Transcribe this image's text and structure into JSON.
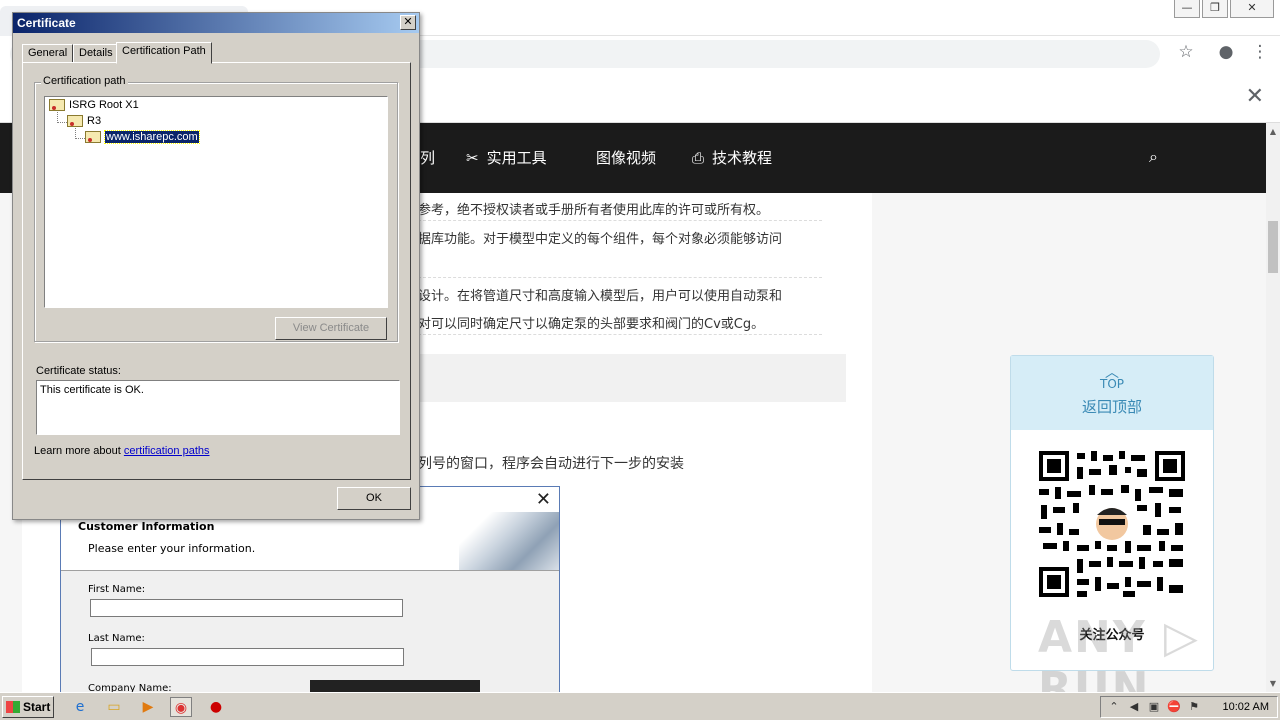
{
  "browser": {
    "window_buttons": [
      "—",
      "❐",
      "✕"
    ],
    "toolbar_icons": [
      "star-icon",
      "account-icon",
      "menu-icon"
    ],
    "infobar_close": "✕"
  },
  "site": {
    "nav": [
      {
        "icon": "",
        "label": "列"
      },
      {
        "icon": "✂",
        "label": "实用工具"
      },
      {
        "icon": "",
        "label": "图像视频"
      },
      {
        "icon": "⎙",
        "label": "技术教程"
      }
    ],
    "search_icon": "⌕"
  },
  "article": {
    "lines": [
      "参考，绝不授权读者或手册所有者使用此库的许可或所有权。",
      "据库功能。对于模型中定义的每个组件，每个对象必须能够访问",
      "设计。在将管道尺寸和高度输入模型后，用户可以使用自动泵和",
      "对可以同时确定尺寸以确定泵的头部要求和阀门的Cv或Cg。"
    ],
    "install_text": "列号的窗口，程序会自动进行下一步的安装"
  },
  "installer": {
    "close": "✕",
    "title": "Customer Information",
    "subtitle": "Please enter your information.",
    "first_name_label": "First Name:",
    "last_name_label": "Last Name:",
    "company_label": "Company Name:"
  },
  "sidebar": {
    "top_arrow": "︿",
    "top_label": "TOP",
    "back_to_top": "返回顶部",
    "qr_caption": "关注公众号"
  },
  "watermark": "ANY ▷ RUN",
  "certificate": {
    "title": "Certificate",
    "close": "✕",
    "tabs": [
      "General",
      "Details",
      "Certification Path"
    ],
    "active_tab": "Certification Path",
    "path_group_label": "Certification path",
    "tree": [
      {
        "label": "ISRG Root X1",
        "level": 0
      },
      {
        "label": "R3",
        "level": 1
      },
      {
        "label": "www.isharepc.com",
        "level": 2,
        "selected": true
      }
    ],
    "view_button": "View Certificate",
    "status_label": "Certificate status:",
    "status_text": "This certificate is OK.",
    "learn_prefix": "Learn more about ",
    "learn_link": "certification paths",
    "ok_button": "OK"
  },
  "taskbar": {
    "start": "Start",
    "clock": "10:02 AM"
  },
  "colors": {
    "nav_bg": "#1b1b1b",
    "title_bar": "#0a246a",
    "accent": "#3a8ab5"
  }
}
